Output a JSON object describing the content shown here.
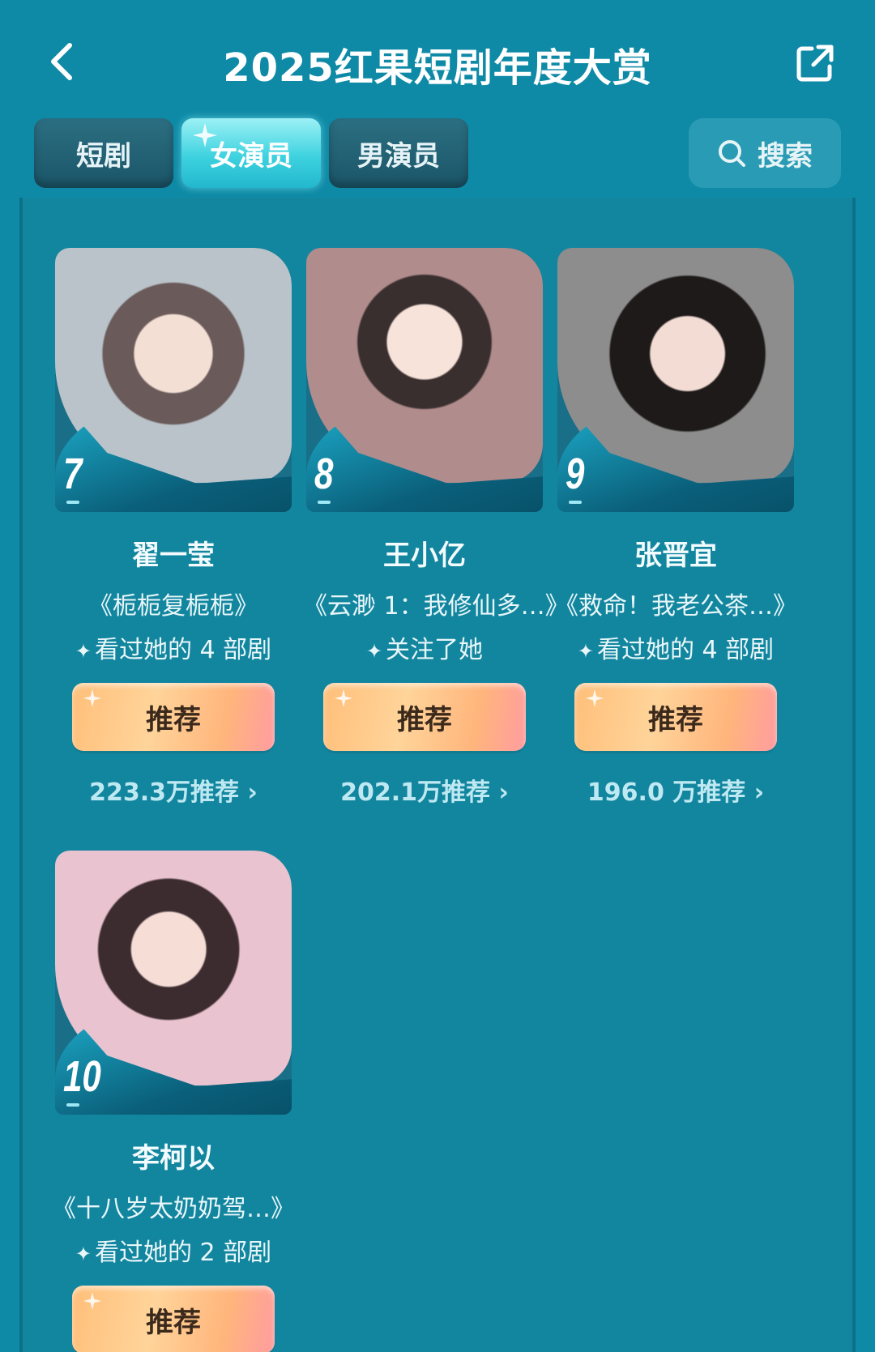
{
  "header": {
    "title": "2025红果短剧年度大赏"
  },
  "tabs": [
    {
      "label": "短剧"
    },
    {
      "label": "女演员"
    },
    {
      "label": "男演员"
    }
  ],
  "search": {
    "label": "搜索"
  },
  "cards": [
    {
      "rank": "7",
      "name": "翟一莹",
      "drama": "《栀栀复栀栀》",
      "note": "看过她的 4 部剧",
      "button": "推荐",
      "count": "223.3万推荐 ›"
    },
    {
      "rank": "8",
      "name": "王小亿",
      "drama": "《云渺 1：我修仙多…》",
      "note": "关注了她",
      "button": "推荐",
      "count": "202.1万推荐 ›"
    },
    {
      "rank": "9",
      "name": "张晋宜",
      "drama": "《救命！我老公茶…》",
      "note": "看过她的 4 部剧",
      "button": "推荐",
      "count": "196.0 万推荐 ›"
    },
    {
      "rank": "10",
      "name": "李柯以",
      "drama": "《十八岁太奶奶驾…》",
      "note": "看过她的 2 部剧",
      "button": "推荐",
      "count": ""
    }
  ],
  "colors": {
    "background": "#0e8aa6",
    "accent_button": "#ffc98a",
    "active_tab": "#3ed2e0"
  },
  "icons": {
    "back": "chevron-left-icon",
    "share": "share-icon",
    "search": "search-icon",
    "sparkle": "sparkle-icon"
  }
}
